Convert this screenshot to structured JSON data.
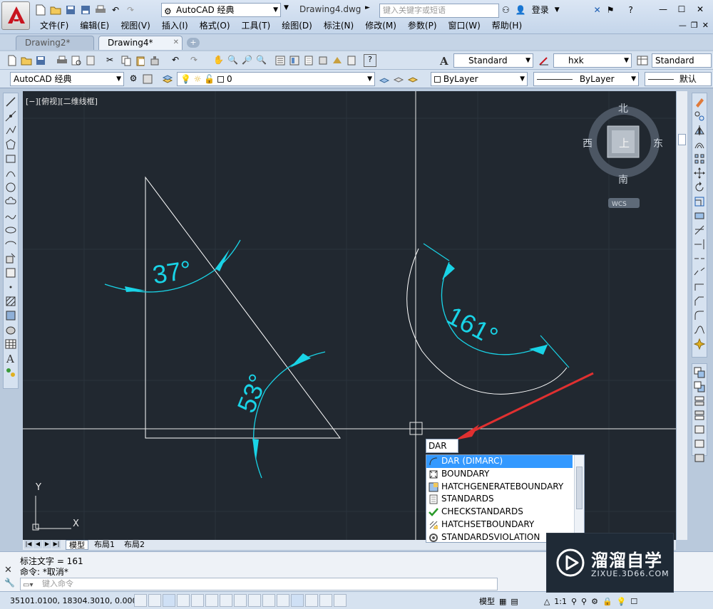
{
  "app": {
    "workspace": "AutoCAD 经典",
    "document_title": "Drawing4.dwg",
    "search_placeholder": "键入关键字或短语",
    "login": "登录"
  },
  "menu": [
    "文件(F)",
    "编辑(E)",
    "视图(V)",
    "插入(I)",
    "格式(O)",
    "工具(T)",
    "绘图(D)",
    "标注(N)",
    "修改(M)",
    "参数(P)",
    "窗口(W)",
    "帮助(H)"
  ],
  "tabs": [
    {
      "label": "Drawing2*",
      "active": false
    },
    {
      "label": "Drawing4*",
      "active": true
    }
  ],
  "toolbar1": {
    "text_style": "Standard",
    "dim_style": "hxk",
    "table_style": "Standard"
  },
  "toolbar2": {
    "workspace": "AutoCAD 经典",
    "layer": "0",
    "color": "ByLayer",
    "linetype": "ByLayer",
    "lineweight": "默认"
  },
  "viewport": {
    "label": "[−][俯视][二维线框]"
  },
  "viewcube": {
    "north": "北",
    "south": "南",
    "west": "西",
    "east": "东",
    "top": "上",
    "wcs": "WCS"
  },
  "drawing": {
    "dim1": "37°",
    "dim2": "53°",
    "dim3": "161°",
    "ucs_x": "X",
    "ucs_y": "Y"
  },
  "autocomplete": {
    "input": "DAR",
    "items": [
      {
        "label": "DAR (DIMARC)",
        "icon": "dimarc-icon",
        "selected": true
      },
      {
        "label": "BOUNDARY",
        "icon": "boundary-icon",
        "selected": false
      },
      {
        "label": "HATCHGENERATEBOUNDARY",
        "icon": "hatch-boundary-icon",
        "selected": false
      },
      {
        "label": "STANDARDS",
        "icon": "standards-icon",
        "selected": false
      },
      {
        "label": "CHECKSTANDARDS",
        "icon": "check-icon",
        "selected": false
      },
      {
        "label": "HATCHSETBOUNDARY",
        "icon": "hatch-set-icon",
        "selected": false
      },
      {
        "label": "STANDARDSVIOLATION",
        "icon": "violation-icon",
        "selected": false
      }
    ]
  },
  "layout_tabs": [
    "模型",
    "布局1",
    "布局2"
  ],
  "command": {
    "history1": "标注文字 = 161",
    "history2": "命令: *取消*",
    "prompt_placeholder": "键入命令"
  },
  "status": {
    "coords": "35101.0100, 18304.3010, 0.0000",
    "model": "模型",
    "scale": "1:1"
  },
  "watermark": {
    "cn": "溜溜自学",
    "en": "ZIXUE.3D66.COM"
  },
  "colors": {
    "canvas": "#212830",
    "dimension": "#19d3e6",
    "geometry": "#ffffff",
    "annotation_arrow": "#e03030",
    "selection": "#3399ff"
  }
}
